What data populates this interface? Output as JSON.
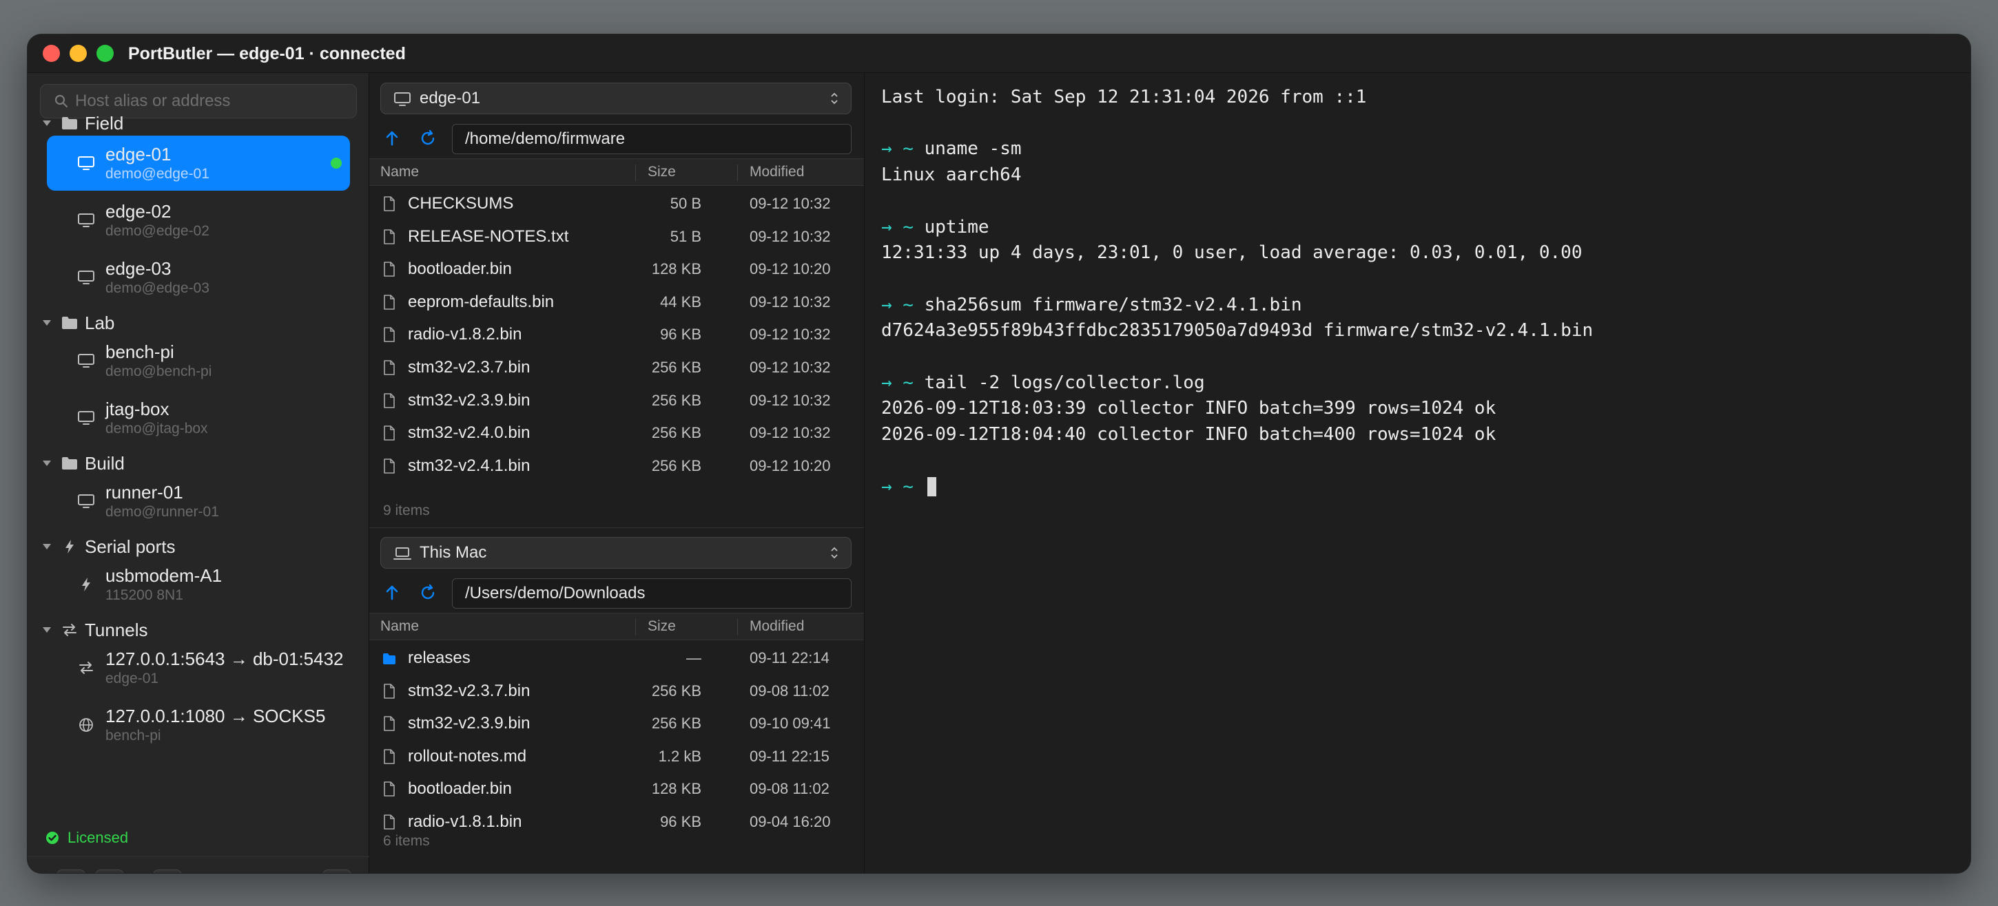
{
  "window": {
    "title": "PortButler — edge-01 · connected"
  },
  "sidebar": {
    "search_placeholder": "Host alias or address",
    "groups": [
      {
        "label": "Field",
        "items": [
          {
            "name": "edge-01",
            "sub": "demo@edge-01",
            "selected": true,
            "connected": true
          },
          {
            "name": "edge-02",
            "sub": "demo@edge-02"
          },
          {
            "name": "edge-03",
            "sub": "demo@edge-03"
          }
        ]
      },
      {
        "label": "Lab",
        "items": [
          {
            "name": "bench-pi",
            "sub": "demo@bench-pi"
          },
          {
            "name": "jtag-box",
            "sub": "demo@jtag-box"
          }
        ]
      },
      {
        "label": "Build",
        "items": [
          {
            "name": "runner-01",
            "sub": "demo@runner-01"
          }
        ]
      },
      {
        "label": "Serial ports",
        "items": [
          {
            "name": "usbmodem-A1",
            "sub": "115200 8N1"
          }
        ]
      },
      {
        "label": "Tunnels",
        "items": [
          {
            "name": "127.0.0.1:5643 → db-01:5432",
            "sub": "edge-01"
          },
          {
            "name": "127.0.0.1:1080 → SOCKS5",
            "sub": "bench-pi"
          }
        ]
      }
    ],
    "license_status": "Licensed"
  },
  "remote_pane": {
    "host": "edge-01",
    "path": "/home/demo/firmware",
    "columns": {
      "name": "Name",
      "size": "Size",
      "modified": "Modified"
    },
    "files": [
      {
        "name": "CHECKSUMS",
        "size": "50 B",
        "modified": "09-12 10:32"
      },
      {
        "name": "RELEASE-NOTES.txt",
        "size": "51 B",
        "modified": "09-12 10:32"
      },
      {
        "name": "bootloader.bin",
        "size": "128 KB",
        "modified": "09-12 10:20"
      },
      {
        "name": "eeprom-defaults.bin",
        "size": "44 KB",
        "modified": "09-12 10:32"
      },
      {
        "name": "radio-v1.8.2.bin",
        "size": "96 KB",
        "modified": "09-12 10:32"
      },
      {
        "name": "stm32-v2.3.7.bin",
        "size": "256 KB",
        "modified": "09-12 10:32"
      },
      {
        "name": "stm32-v2.3.9.bin",
        "size": "256 KB",
        "modified": "09-12 10:32"
      },
      {
        "name": "stm32-v2.4.0.bin",
        "size": "256 KB",
        "modified": "09-12 10:32"
      },
      {
        "name": "stm32-v2.4.1.bin",
        "size": "256 KB",
        "modified": "09-12 10:20"
      }
    ],
    "count_label": "9 items"
  },
  "local_pane": {
    "host": "This Mac",
    "path": "/Users/demo/Downloads",
    "columns": {
      "name": "Name",
      "size": "Size",
      "modified": "Modified"
    },
    "files": [
      {
        "name": "releases",
        "size": "—",
        "modified": "09-11 22:14",
        "folder": true
      },
      {
        "name": "stm32-v2.3.7.bin",
        "size": "256 KB",
        "modified": "09-08 11:02"
      },
      {
        "name": "stm32-v2.3.9.bin",
        "size": "256 KB",
        "modified": "09-10 09:41"
      },
      {
        "name": "rollout-notes.md",
        "size": "1.2 kB",
        "modified": "09-11 22:15"
      },
      {
        "name": "bootloader.bin",
        "size": "128 KB",
        "modified": "09-08 11:02"
      },
      {
        "name": "radio-v1.8.1.bin",
        "size": "96 KB",
        "modified": "09-04 16:20"
      }
    ],
    "count_label": "6 items"
  },
  "terminal": {
    "prompt": "→ ~",
    "lines": [
      {
        "text": "Last login: Sat Sep 12 21:31:04 2026 from ::1"
      },
      {
        "text": ""
      },
      {
        "cmd": "uname -sm"
      },
      {
        "text": "Linux aarch64"
      },
      {
        "text": ""
      },
      {
        "cmd": "uptime"
      },
      {
        "text": "12:31:33 up 4 days, 23:01, 0 user, load average: 0.03, 0.01, 0.00"
      },
      {
        "text": ""
      },
      {
        "cmd": "sha256sum firmware/stm32-v2.4.1.bin"
      },
      {
        "text": "d7624a3e955f89b43ffdbc2835179050a7d9493d firmware/stm32-v2.4.1.bin"
      },
      {
        "text": ""
      },
      {
        "cmd": "tail -2 logs/collector.log"
      },
      {
        "text": "2026-09-12T18:03:39 collector INFO batch=399 rows=1024 ok"
      },
      {
        "text": "2026-09-12T18:04:40 collector INFO batch=400 rows=1024 ok"
      },
      {
        "text": ""
      },
      {
        "cmd": "",
        "cursor": true
      }
    ]
  },
  "colors": {
    "accent": "#0a84ff",
    "connected": "#32d74b",
    "prompt": "#2fd0c4"
  },
  "icons": {
    "search": "magnifier-icon",
    "group": "folder-icon",
    "host": "monitor-icon",
    "serial": "bolt-icon",
    "tunnel": "swap-arrows-icon",
    "socks": "globe-icon",
    "file": "document-icon",
    "folder": "folder-icon",
    "up": "arrow-up-icon",
    "refresh": "refresh-icon",
    "add": "plus-icon",
    "edit": "pencil-icon",
    "delete": "trash-icon",
    "settings": "gear-icon"
  }
}
